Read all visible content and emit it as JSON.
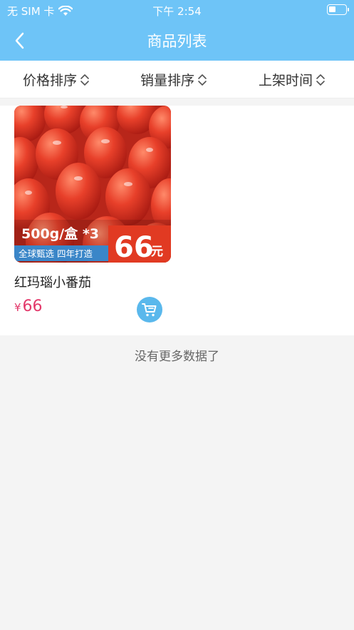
{
  "status_bar": {
    "carrier": "无 SIM 卡",
    "time": "下午 2:54",
    "battery_level": 0.45
  },
  "nav": {
    "title": "商品列表",
    "back_icon": "chevron-left-icon"
  },
  "sort_bar": {
    "items": [
      {
        "label": "价格排序",
        "icon": "sort-updown-icon"
      },
      {
        "label": "销量排序",
        "icon": "sort-updown-icon"
      },
      {
        "label": "上架时间",
        "icon": "sort-updown-icon"
      }
    ]
  },
  "products": [
    {
      "name": "红玛瑙小番茄",
      "currency_symbol": "¥",
      "price": "66",
      "image": {
        "spec": "500g/盒 *3",
        "tagline": "全球甄选  四年打造",
        "price_tag": "66",
        "price_unit": "元"
      },
      "cart_icon": "cart-icon"
    }
  ],
  "footer": {
    "no_more_text": "没有更多数据了"
  },
  "colors": {
    "header_bg": "#6ec4f7",
    "price": "#e3386a",
    "cart_button": "#5ab8ec",
    "tomato": "#d23a2a",
    "banner_blue": "#3a86c8",
    "price_tag_bg": "#e13a22"
  }
}
